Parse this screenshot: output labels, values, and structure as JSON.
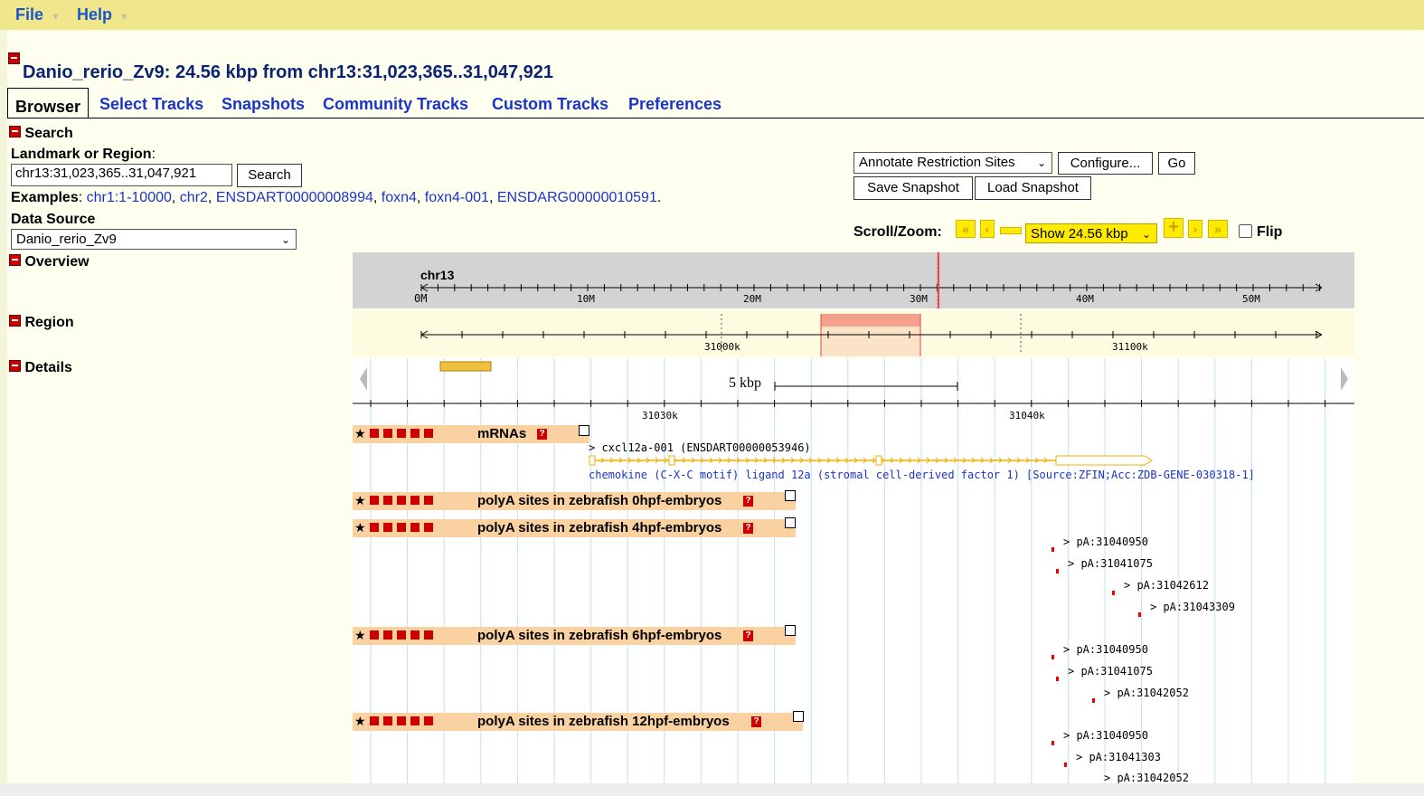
{
  "menubar": {
    "file": "File",
    "help": "Help"
  },
  "header": {
    "title": "Danio_rerio_Zv9: 24.56 kbp from chr13:31,023,365..31,047,921"
  },
  "tabs": [
    "Browser",
    "Select Tracks",
    "Snapshots",
    "Community Tracks",
    "Custom Tracks",
    "Preferences"
  ],
  "search": {
    "section_label": "Search",
    "landmark_label": "Landmark or Region",
    "landmark_colon": ":",
    "input_value": "chr13:31,023,365..31,047,921",
    "search_button": "Search",
    "examples_label": "Examples",
    "examples": [
      "chr1:1-10000",
      "chr2",
      "ENSDART00000008994",
      "foxn4",
      "foxn4-001",
      "ENSDARG00000010591"
    ],
    "data_source_label": "Data Source",
    "data_source_value": "Danio_rerio_Zv9"
  },
  "tools": {
    "plugin_select": "Annotate Restriction Sites",
    "configure_button": "Configure...",
    "go_button": "Go",
    "save_snapshot": "Save Snapshot",
    "load_snapshot": "Load Snapshot",
    "scroll_zoom_label": "Scroll/Zoom:",
    "zoom_select": "Show 24.56 kbp",
    "flip_label": "Flip",
    "flip_checked": false
  },
  "sections": {
    "overview": "Overview",
    "region": "Region",
    "details": "Details"
  },
  "overview": {
    "chrom": "chr13",
    "ticks": [
      "0M",
      "10M",
      "20M",
      "30M",
      "40M",
      "50M"
    ]
  },
  "region": {
    "ticks": [
      "31000k",
      "31100k"
    ]
  },
  "details": {
    "scale_label": "5 kbp",
    "ticks": [
      "31030k",
      "31040k"
    ],
    "tracks": [
      {
        "name": "mRNAs"
      },
      {
        "name": "polyA sites in zebrafish 0hpf-embryos"
      },
      {
        "name": "polyA sites in zebrafish 4hpf-embryos"
      },
      {
        "name": "polyA sites in zebrafish 6hpf-embryos"
      },
      {
        "name": "polyA sites in zebrafish 12hpf-embryos"
      }
    ],
    "mrna": {
      "name": "cxcl12a-001 (ENSDART00000053946)",
      "description": "chemokine (C-X-C motif) ligand 12a (stromal cell-derived factor 1) [Source:ZFIN;Acc:ZDB-GENE-030318-1]"
    },
    "polya_4hpf": [
      "pA:31040950",
      "pA:31041075",
      "pA:31042612",
      "pA:31043309"
    ],
    "polya_6hpf": [
      "pA:31040950",
      "pA:31041075",
      "pA:31042052"
    ],
    "polya_12hpf": [
      "pA:31040950",
      "pA:31041303",
      "pA:31042052"
    ]
  },
  "colors": {
    "menubar": "#f0e68c",
    "link": "#1a34c9",
    "track_header": "#fad1a0",
    "overview_bg": "#d3d3d3",
    "highlight": "#f5a08c"
  }
}
